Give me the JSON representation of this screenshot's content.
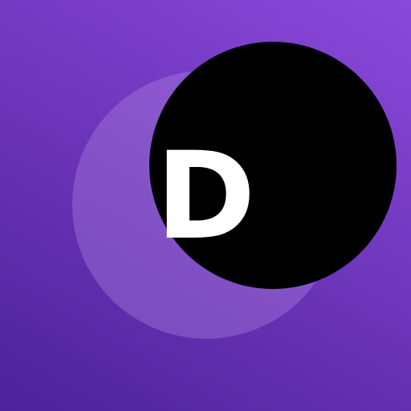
{
  "icon": {
    "letter": "D",
    "colors": {
      "background_start": "#4b239a",
      "background_end": "#8a49db",
      "dark_circle": "#000000",
      "light_circle": "#b48ce6",
      "letter": "#ffffff"
    }
  }
}
